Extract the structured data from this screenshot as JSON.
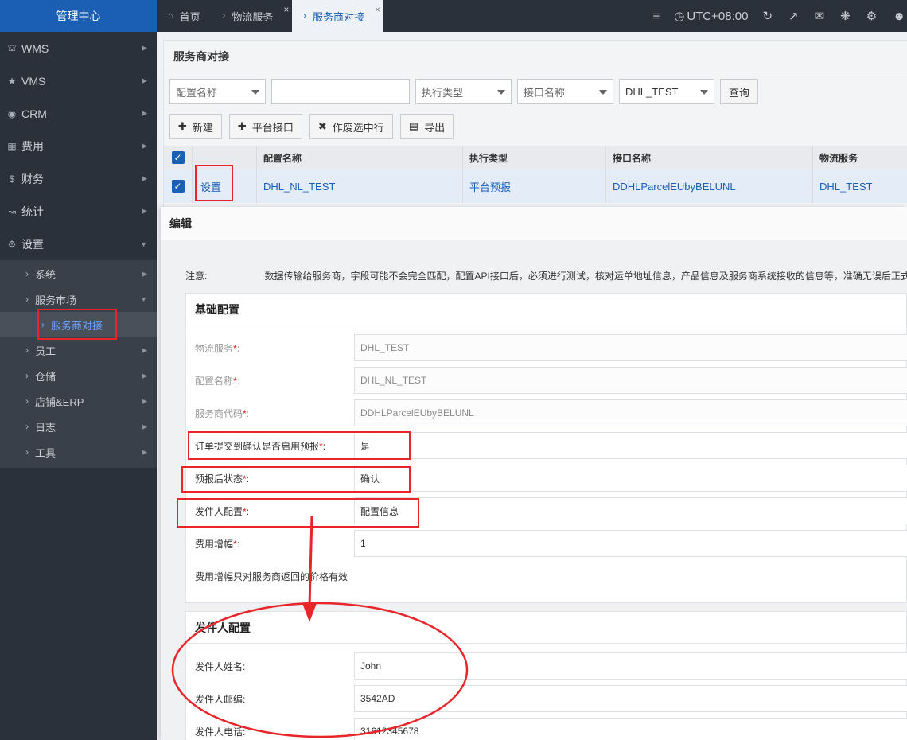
{
  "sidebar": {
    "brand": "管理中心",
    "items": [
      {
        "label": "WMS",
        "icon": "bank-icon"
      },
      {
        "label": "VMS",
        "icon": "star-icon"
      },
      {
        "label": "CRM",
        "icon": "user-circle-icon"
      },
      {
        "label": "费用",
        "icon": "grid-icon"
      },
      {
        "label": "财务",
        "icon": "dollar-icon"
      },
      {
        "label": "统计",
        "icon": "chart-icon"
      },
      {
        "label": "设置",
        "icon": "gear-icon"
      }
    ],
    "subitems": [
      {
        "label": "系统"
      },
      {
        "label": "服务市场"
      },
      {
        "label": "服务商对接"
      },
      {
        "label": "员工"
      },
      {
        "label": "仓储"
      },
      {
        "label": "店铺&ERP"
      },
      {
        "label": "日志"
      },
      {
        "label": "工具"
      }
    ]
  },
  "topbar": {
    "tabs": [
      {
        "label": "首页"
      },
      {
        "label": "物流服务"
      },
      {
        "label": "服务商对接"
      }
    ],
    "timezone": "UTC+08:00"
  },
  "panel": {
    "title": "服务商对接",
    "filters": {
      "config_name": "配置名称",
      "exec_type": "执行类型",
      "api_name": "接口名称",
      "service": "DHL_TEST",
      "query": "查询"
    },
    "actions": {
      "new": "新建",
      "platform_api": "平台接口",
      "void_selected": "作废选中行",
      "export": "导出"
    },
    "table": {
      "headers": [
        "配置名称",
        "执行类型",
        "接口名称",
        "物流服务"
      ],
      "row": {
        "action": "设置",
        "config_name": "DHL_NL_TEST",
        "exec_type": "平台预报",
        "api_name": "DDHLParcelEUbyBELUNL",
        "service": "DHL_TEST"
      }
    }
  },
  "modal": {
    "title": "编辑",
    "notice_label": "注意:",
    "notice_text": "数据传输给服务商，字段可能不会完全匹配，配置API接口后，必须进行测试，核对运单地址信息，产品信息及服务商系统接收的信息等，准确无误后正式",
    "basic": {
      "title": "基础配置",
      "fields": [
        {
          "label": "物流服务",
          "value": "DHL_TEST"
        },
        {
          "label": "配置名称",
          "value": "DHL_NL_TEST"
        },
        {
          "label": "服务商代码",
          "value": "DDHLParcelEUbyBELUNL"
        },
        {
          "label": "订单提交到确认是否启用预报",
          "value": "是"
        },
        {
          "label": "预报后状态",
          "value": "确认"
        },
        {
          "label": "发件人配置",
          "value": "配置信息"
        },
        {
          "label": "费用增幅",
          "value": "1"
        }
      ],
      "hint": "费用增幅只对服务商返回的价格有效"
    },
    "sender": {
      "title": "发件人配置",
      "fields": [
        {
          "label": "发件人姓名:",
          "value": "John"
        },
        {
          "label": "发件人邮编:",
          "value": "3542AD"
        },
        {
          "label": "发件人电话:",
          "value": "31612345678"
        }
      ]
    }
  },
  "colors": {
    "accent": "#1a5fb4",
    "sidebar_bg": "#2b313b",
    "annotation_red": "#e8262a"
  }
}
